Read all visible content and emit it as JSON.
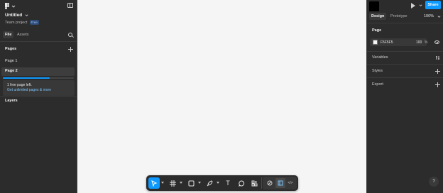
{
  "app": {
    "file_name": "Untitled",
    "team_label": "Team project",
    "plan_badge": "Free"
  },
  "left_panel": {
    "tabs": [
      {
        "label": "File",
        "active": true
      },
      {
        "label": "Assets",
        "active": false
      }
    ],
    "pages_heading": "Pages",
    "pages": [
      {
        "label": "Page 1",
        "selected": false
      },
      {
        "label": "Page 2",
        "selected": true
      }
    ],
    "page_quota": {
      "fraction_used": 0.66,
      "message": "1 free page left.",
      "link": "Get unlimited pages & more"
    },
    "layers_heading": "Layers"
  },
  "right_panel": {
    "share_label": "Share",
    "tabs": [
      {
        "label": "Design",
        "active": true
      },
      {
        "label": "Prototype",
        "active": false
      }
    ],
    "zoom": "100%",
    "page_section": {
      "title": "Page",
      "background_hex": "F5F5F5",
      "opacity": "100",
      "opacity_unit": "%"
    },
    "sections": [
      {
        "label": "Variables"
      },
      {
        "label": "Styles"
      },
      {
        "label": "Export"
      }
    ],
    "help_label": "?"
  },
  "toolbar": {
    "tools": [
      {
        "name": "move-tool",
        "icon": "cursor-icon",
        "active": true
      },
      {
        "name": "frame-tool",
        "icon": "frame-icon",
        "active": false
      },
      {
        "name": "shape-tool",
        "icon": "rectangle-icon",
        "active": false
      },
      {
        "name": "pen-tool",
        "icon": "pen-icon",
        "active": false
      },
      {
        "name": "text-tool",
        "icon": "text-icon",
        "active": false
      },
      {
        "name": "comment-tool",
        "icon": "comment-icon",
        "active": false
      },
      {
        "name": "actions-tool",
        "icon": "actions-icon",
        "active": false
      }
    ],
    "text_tool_glyph": "T",
    "mode_labels": [
      "",
      "",
      "</>"
    ]
  },
  "colors": {
    "accent": "#0d99ff",
    "panel_bg": "#2c2c2c",
    "canvas_bg": "#f5f5f5"
  }
}
